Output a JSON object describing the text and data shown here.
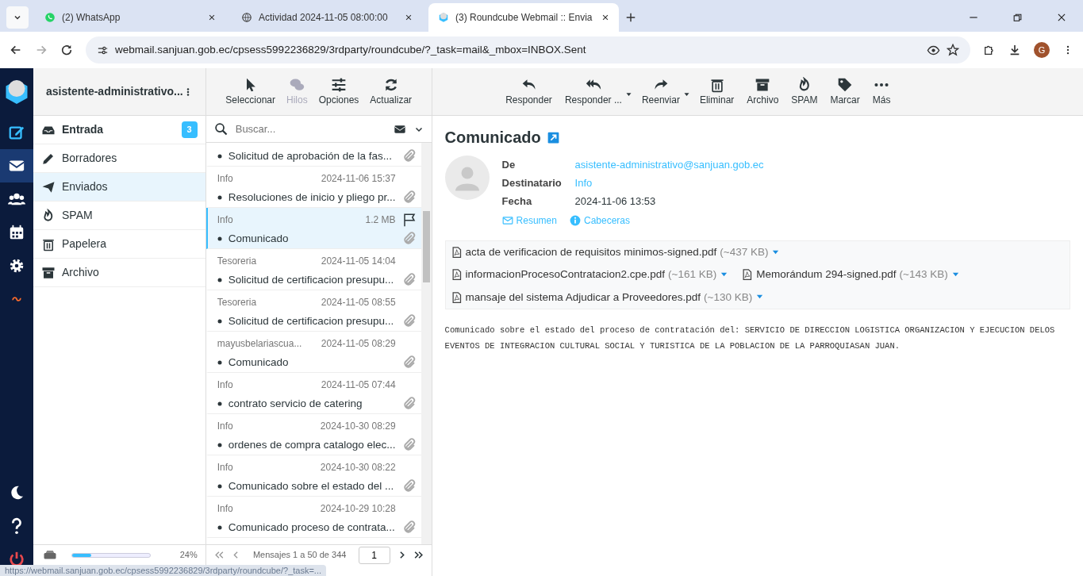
{
  "browser": {
    "tabs": [
      {
        "title": "(2) WhatsApp",
        "selected": false
      },
      {
        "title": "Actividad 2024-11-05 08:00:00",
        "selected": false
      },
      {
        "title": "(3) Roundcube Webmail :: Envia",
        "selected": true
      }
    ],
    "url": "webmail.sanjuan.gob.ec/cpsess5992236829/3rdparty/roundcube/?_task=mail&_mbox=INBOX.Sent",
    "profile_initial": "G"
  },
  "nav": {
    "items": [
      {
        "selected": false
      },
      {
        "selected": true
      },
      {
        "selected": false
      },
      {
        "selected": false
      },
      {
        "selected": false
      },
      {
        "selected": false
      }
    ]
  },
  "account": "asistente-administrativo...",
  "folders": [
    {
      "label": "Entrada",
      "selected": false,
      "unread": "3"
    },
    {
      "label": "Borradores",
      "selected": false
    },
    {
      "label": "Enviados",
      "selected": true
    },
    {
      "label": "SPAM",
      "selected": false
    },
    {
      "label": "Papelera",
      "selected": false
    },
    {
      "label": "Archivo",
      "selected": false
    }
  ],
  "quota": {
    "level": 0.24,
    "text": "24%"
  },
  "list_toolbar": [
    {
      "label": "Seleccionar",
      "disabled": false
    },
    {
      "label": "Hilos",
      "disabled": true
    },
    {
      "label": "Opciones",
      "disabled": false
    },
    {
      "label": "Actualizar",
      "disabled": false
    }
  ],
  "search": {
    "placeholder": "Buscar..."
  },
  "messages": [
    {
      "subject": "Solicitud de aprobación de la fas...",
      "attachment": true,
      "selected": false
    },
    {
      "from": "Info",
      "date": "2024-11-06 15:37",
      "subject": "Resoluciones de inicio y pliego pr...",
      "attachment": true,
      "flagged": false,
      "selected": false
    },
    {
      "from": "Info",
      "date": "1.2 MB",
      "subject": "Comunicado",
      "attachment": true,
      "flagged": true,
      "selected": true
    },
    {
      "from": "Tesoreria",
      "date": "2024-11-05 14:04",
      "subject": "Solicitud de certificacion presupu...",
      "attachment": true,
      "flagged": false,
      "selected": false
    },
    {
      "from": "Tesoreria",
      "date": "2024-11-05 08:55",
      "subject": "Solicitud de certificacion presupu...",
      "attachment": true,
      "flagged": false,
      "selected": false
    },
    {
      "from": "mayusbelariascua...",
      "date": "2024-11-05 08:29",
      "subject": "Comunicado",
      "attachment": true,
      "flagged": false,
      "selected": false
    },
    {
      "from": "Info",
      "date": "2024-11-05 07:44",
      "subject": "contrato servicio de catering",
      "attachment": true,
      "flagged": false,
      "selected": false
    },
    {
      "from": "Info",
      "date": "2024-10-30 08:29",
      "subject": "ordenes de compra catalogo elec...",
      "attachment": true,
      "flagged": false,
      "selected": false
    },
    {
      "from": "Info",
      "date": "2024-10-30 08:22",
      "subject": "Comunicado sobre el estado del ...",
      "attachment": true,
      "flagged": false,
      "selected": false
    },
    {
      "from": "Info",
      "date": "2024-10-29 10:28",
      "subject": "Comunicado proceso de contrata...",
      "attachment": true,
      "flagged": false,
      "selected": false
    }
  ],
  "pagination": {
    "text": "Mensajes 1 a 50 de 344",
    "page": "1"
  },
  "status_url": "https://webmail.sanjuan.gob.ec/cpsess5992236829/3rdparty/roundcube/?_task=...",
  "message_toolbar": [
    {
      "label": "Responder",
      "dropdown": false
    },
    {
      "label": "Responder ...",
      "dropdown": true
    },
    {
      "label": "Reenviar",
      "dropdown": true
    },
    {
      "label": "Eliminar",
      "dropdown": false
    },
    {
      "label": "Archivo",
      "dropdown": false
    },
    {
      "label": "SPAM",
      "dropdown": false
    },
    {
      "label": "Marcar",
      "dropdown": false
    },
    {
      "label": "Más",
      "dropdown": false
    }
  ],
  "message": {
    "subject": "Comunicado",
    "headers": [
      {
        "label": "De",
        "value": "asistente-administrativo@sanjuan.gob.ec",
        "kind": "link"
      },
      {
        "label": "Destinatario",
        "value": "Info",
        "kind": "link"
      },
      {
        "label": "Fecha",
        "value": "2024-11-06 13:53",
        "kind": "text"
      }
    ],
    "header_links": [
      {
        "label": "Resumen"
      },
      {
        "label": "Cabeceras"
      }
    ],
    "attachments": [
      [
        {
          "name": "acta de verificacion de requisitos minimos-signed.pdf",
          "size": "(~437 KB)"
        }
      ],
      [
        {
          "name": "informacionProcesoContratacion2.cpe.pdf",
          "size": "(~161 KB)"
        },
        {
          "name": "Memorándum 294-signed.pdf",
          "size": "(~143 KB)"
        }
      ],
      [
        {
          "name": "mansaje del sistema Adjudicar a Proveedores.pdf",
          "size": "(~130 KB)"
        }
      ]
    ],
    "body": "Comunicado sobre el estado del proceso de contratación del: SERVICIO DE DIRECCION LOGISTICA ORGANIZACION Y EJECUCION DELOS EVENTOS DE INTEGRACION CULTURAL SOCIAL Y TURISTICA DE LA POBLACION DE LA PARROQUIASAN JUAN."
  }
}
